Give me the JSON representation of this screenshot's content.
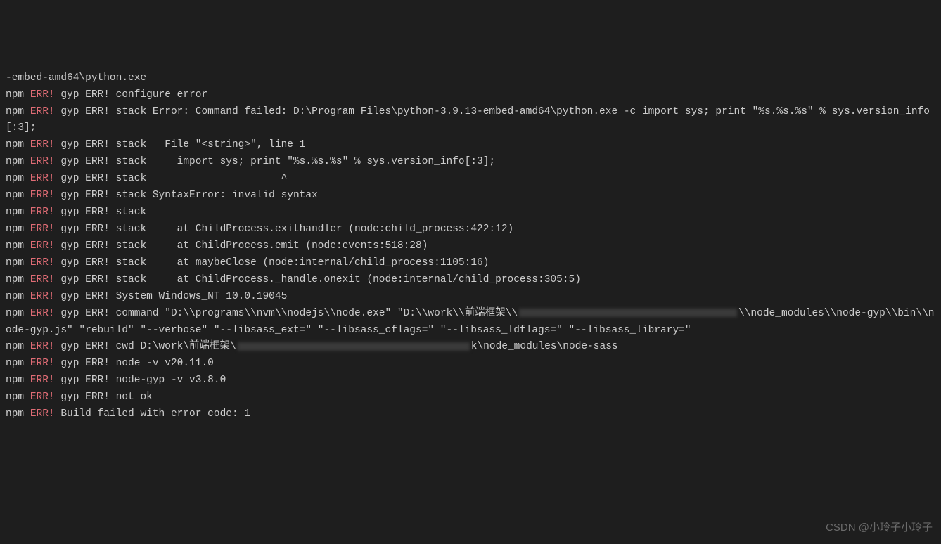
{
  "lines": [
    {
      "prefix": "",
      "err": "",
      "text": "-embed-amd64\\python.exe"
    },
    {
      "prefix": "npm ",
      "err": "ERR!",
      "text": " gyp ERR! configure error"
    },
    {
      "prefix": "npm ",
      "err": "ERR!",
      "text": " gyp ERR! stack Error: Command failed: D:\\Program Files\\python-3.9.13-embed-amd64\\python.exe -c import sys; print \"%s.%s.%s\" % sys.version_info[:3];"
    },
    {
      "prefix": "npm ",
      "err": "ERR!",
      "text": " gyp ERR! stack   File \"<string>\", line 1"
    },
    {
      "prefix": "npm ",
      "err": "ERR!",
      "text": " gyp ERR! stack     import sys; print \"%s.%s.%s\" % sys.version_info[:3];"
    },
    {
      "prefix": "npm ",
      "err": "ERR!",
      "text": " gyp ERR! stack                      ^"
    },
    {
      "prefix": "npm ",
      "err": "ERR!",
      "text": " gyp ERR! stack SyntaxError: invalid syntax"
    },
    {
      "prefix": "npm ",
      "err": "ERR!",
      "text": " gyp ERR! stack"
    },
    {
      "prefix": "npm ",
      "err": "ERR!",
      "text": " gyp ERR! stack     at ChildProcess.exithandler (node:child_process:422:12)"
    },
    {
      "prefix": "npm ",
      "err": "ERR!",
      "text": " gyp ERR! stack     at ChildProcess.emit (node:events:518:28)"
    },
    {
      "prefix": "npm ",
      "err": "ERR!",
      "text": " gyp ERR! stack     at maybeClose (node:internal/child_process:1105:16)"
    },
    {
      "prefix": "npm ",
      "err": "ERR!",
      "text": " gyp ERR! stack     at ChildProcess._handle.onexit (node:internal/child_process:305:5)"
    },
    {
      "prefix": "npm ",
      "err": "ERR!",
      "text": " gyp ERR! System Windows_NT 10.0.19045"
    },
    {
      "prefix": "npm ",
      "err": "ERR!",
      "text": " gyp ERR! command \"D:\\\\programs\\\\nvm\\\\nodejs\\\\node.exe\" \"D:\\\\work\\\\前端框架\\\\",
      "redacted1": true,
      "textAfter": "\\\\node_modules\\\\node-gyp\\\\bin\\\\node-gyp.js\" \"rebuild\" \"--verbose\" \"--libsass_ext=\" \"--libsass_cflags=\" \"--libsass_ldflags=\" \"--libsass_library=\""
    },
    {
      "prefix": "npm ",
      "err": "ERR!",
      "text": " gyp ERR! cwd D:\\work\\前端框架\\",
      "redacted2": true,
      "textAfter": "k\\node_modules\\node-sass"
    },
    {
      "prefix": "npm ",
      "err": "ERR!",
      "text": " gyp ERR! node -v v20.11.0"
    },
    {
      "prefix": "npm ",
      "err": "ERR!",
      "text": " gyp ERR! node-gyp -v v3.8.0"
    },
    {
      "prefix": "npm ",
      "err": "ERR!",
      "text": " gyp ERR! not ok"
    },
    {
      "prefix": "npm ",
      "err": "ERR!",
      "text": " Build failed with error code: 1"
    }
  ],
  "watermark": "CSDN @小玲子小玲子"
}
